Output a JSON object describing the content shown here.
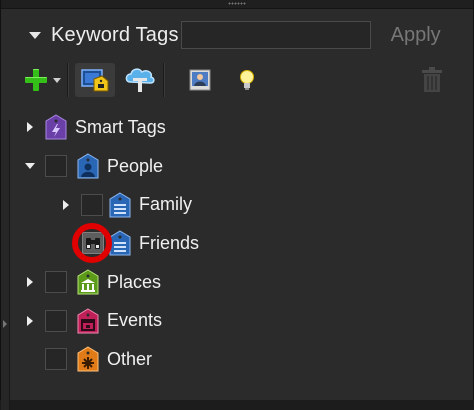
{
  "header": {
    "title": "Keyword Tags",
    "tag_input_value": "",
    "apply_label": "Apply"
  },
  "toolbar": {
    "buttons": [
      "plus-icon",
      "tag-with-face-icon",
      "cloud-tag-icon",
      "photo-icon",
      "lightbulb-icon",
      "trash-icon"
    ]
  },
  "tree": {
    "items": [
      {
        "label": "Smart Tags",
        "level": 0,
        "expander": "collapsed",
        "checkbox": false,
        "icon": "smart-tags-icon",
        "color": "#6b3fa8"
      },
      {
        "label": "People",
        "level": 0,
        "expander": "expanded",
        "checkbox": true,
        "icon": "people-tag-icon",
        "color": "#2a66b6"
      },
      {
        "label": "Family",
        "level": 1,
        "expander": "collapsed",
        "checkbox": true,
        "icon": "tag-icon",
        "color": "#2a66b6"
      },
      {
        "label": "Friends",
        "level": 1,
        "expander": "none",
        "checkbox": false,
        "icon": "tag-icon",
        "color": "#2a66b6",
        "find_icon": "binoculars-icon",
        "highlighted": true
      },
      {
        "label": "Places",
        "level": 0,
        "expander": "collapsed",
        "checkbox": true,
        "icon": "places-tag-icon",
        "color": "#5c9b1a"
      },
      {
        "label": "Events",
        "level": 0,
        "expander": "collapsed",
        "checkbox": true,
        "icon": "events-tag-icon",
        "color": "#c01f57"
      },
      {
        "label": "Other",
        "level": 0,
        "expander": "none",
        "checkbox": true,
        "icon": "other-tag-icon",
        "color": "#e07b18"
      }
    ]
  },
  "colors": {
    "panel_bg": "#2b2b2b",
    "accent_green": "#34c019",
    "highlight_red": "#e00000"
  }
}
